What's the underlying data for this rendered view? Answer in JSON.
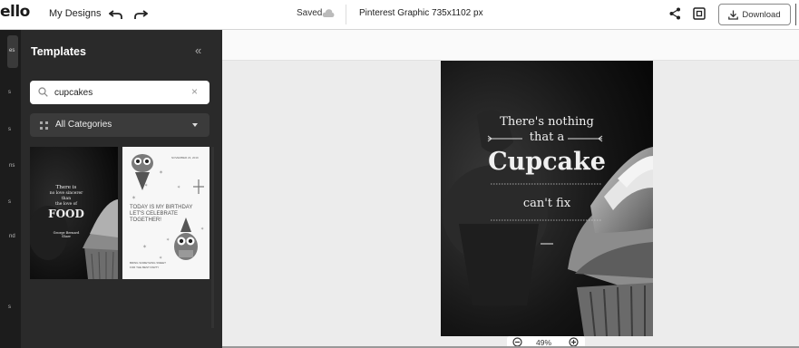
{
  "app": {
    "logo_text": "ello",
    "my_designs": "My Designs",
    "save_status": "Saved",
    "document_title": "Pinterest Graphic 735x1102 px",
    "download_label": "Download"
  },
  "rail": {
    "labels": [
      "es",
      "s",
      "s",
      "ns",
      "s",
      "nd",
      "s"
    ]
  },
  "templates_panel": {
    "title": "Templates",
    "collapse_glyph": "«",
    "search": {
      "value": "cupcakes",
      "clear_glyph": "×"
    },
    "category_label": "All Categories",
    "thumbnails": [
      {
        "lines": [
          "There is",
          "no love sincerer",
          "than",
          "the love of",
          "FOOD",
          "George Bernard",
          "Shaw"
        ]
      },
      {
        "header": "NOVEMBER 23, 2019",
        "lines": [
          "TODAY IS MY BIRTHDAY",
          "LET'S CELEBRATE",
          "TOGETHER!"
        ],
        "footer": [
          "BRING SOMETHING SWEET",
          "FOR THE BEST PARTY"
        ]
      }
    ]
  },
  "artboard": {
    "line1": "There's nothing",
    "line2": "that a",
    "headline": "Cupcake",
    "line3": "can't fix"
  },
  "zoom": {
    "value": "49%",
    "minus_glyph": "−",
    "plus_glyph": "+"
  }
}
